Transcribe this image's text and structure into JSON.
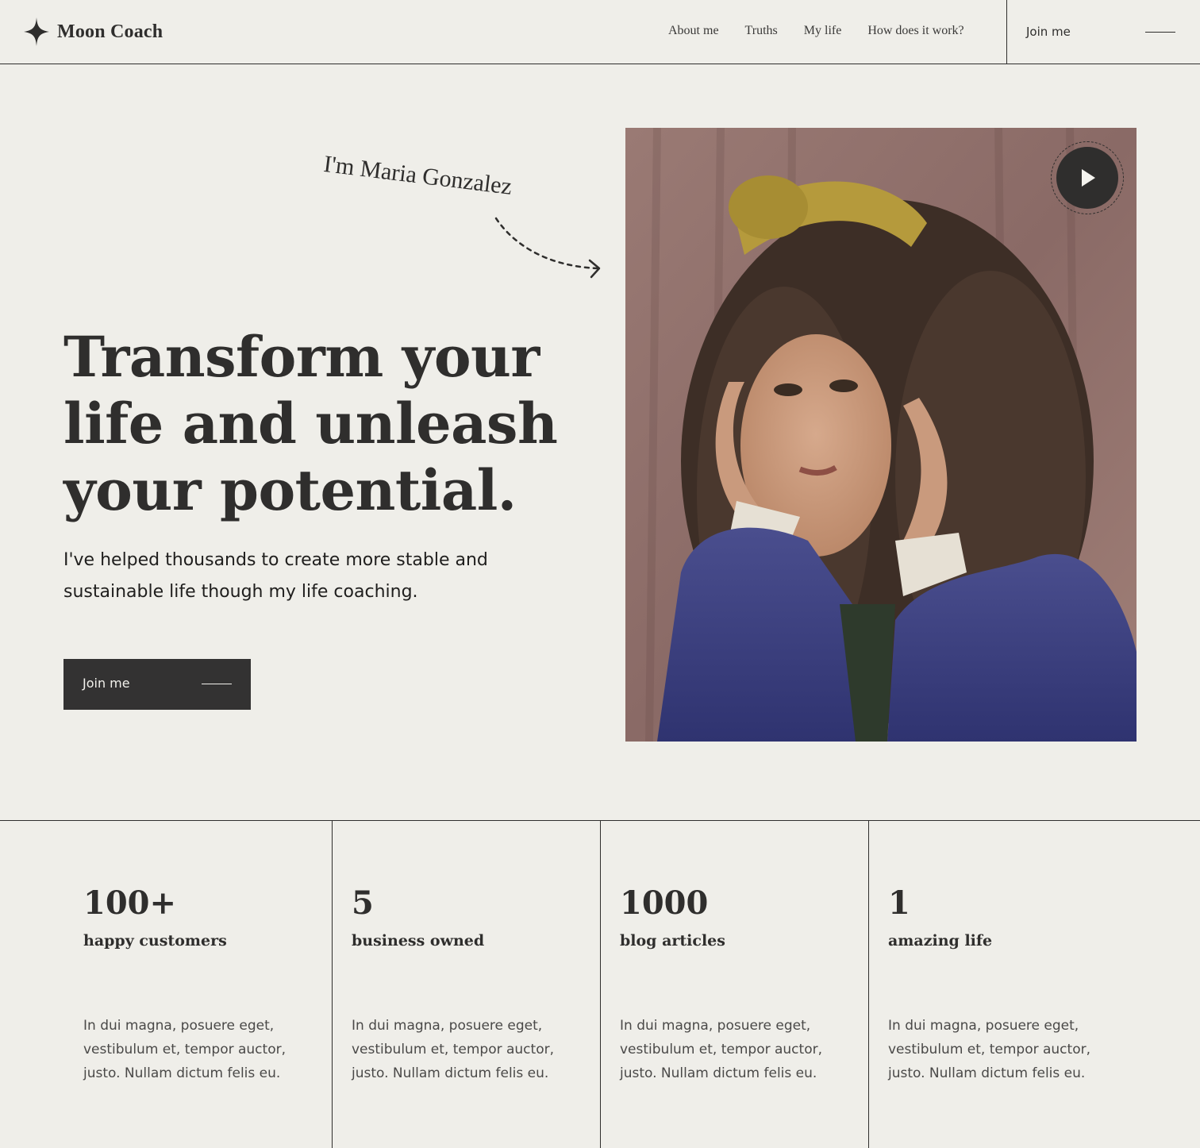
{
  "header": {
    "logo_text": "Moon Coach",
    "nav": [
      "About me",
      "Truths",
      "My life",
      "How does it work?"
    ],
    "join_label": "Join me"
  },
  "hero": {
    "intro": "I'm Maria Gonzalez",
    "headline": "Transform your life and unleash your potential.",
    "subtext": "I've helped thousands to create more stable and sustainable life though my life coaching.",
    "cta_label": "Join me",
    "icons": {
      "logo": "four-point-star-icon",
      "play": "play-icon",
      "arrow": "dashed-arrow-icon"
    }
  },
  "stats": [
    {
      "number": "100+",
      "label": "happy customers",
      "desc": "In dui magna, posuere eget, vestibulum et, tempor auctor, justo. Nullam dictum felis eu."
    },
    {
      "number": "5",
      "label": "business owned",
      "desc": "In dui magna, posuere eget, vestibulum et, tempor auctor, justo. Nullam dictum felis eu."
    },
    {
      "number": "1000",
      "label": "blog articles",
      "desc": "In dui magna, posuere eget, vestibulum et, tempor auctor, justo. Nullam dictum felis eu."
    },
    {
      "number": "1",
      "label": "amazing life",
      "desc": "In dui magna, posuere eget, vestibulum et, tempor auctor, justo. Nullam dictum felis eu."
    }
  ],
  "colors": {
    "background": "#efeee9",
    "ink": "#2f2e2d",
    "button": "#333232"
  }
}
